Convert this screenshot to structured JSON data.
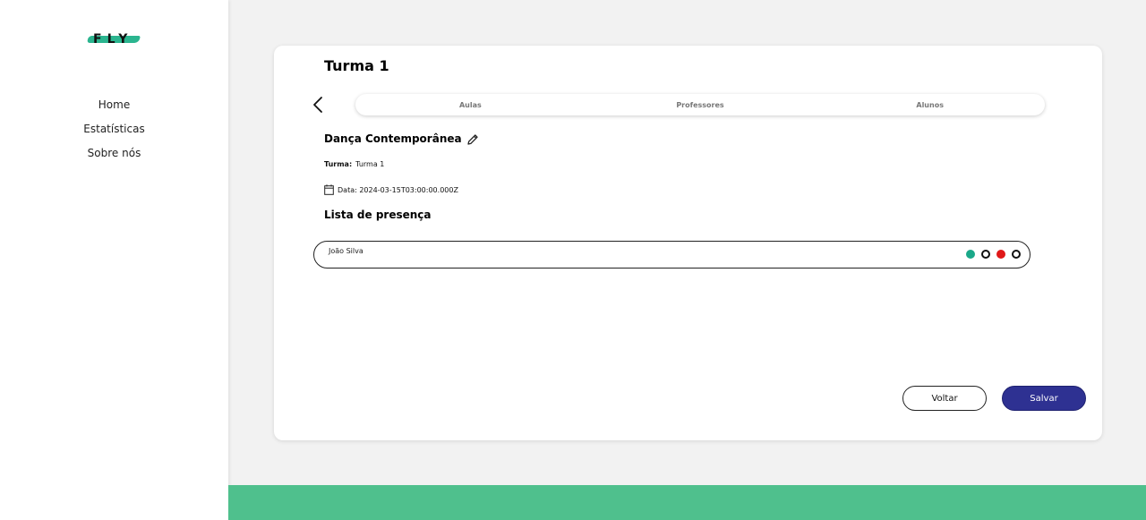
{
  "brand": {
    "logo_text": "FLY",
    "accent": "#2bb58f"
  },
  "sidebar": {
    "items": [
      {
        "label": "Home"
      },
      {
        "label": "Estatísticas"
      },
      {
        "label": "Sobre nós"
      }
    ]
  },
  "card": {
    "title": "Turma 1",
    "tabs": [
      {
        "label": "Aulas"
      },
      {
        "label": "Professores"
      },
      {
        "label": "Alunos"
      }
    ],
    "subject": "Dança Contemporânea",
    "turma_label": "Turma:",
    "turma_value": "Turma 1",
    "date_text": "Data: 2024-03-15T03:00:00.000Z",
    "attendance_title": "Lista de presença",
    "students": [
      {
        "name": "João Silva",
        "status_colors": [
          "#1aa889",
          "outline",
          "#e01818",
          "outline"
        ]
      }
    ],
    "buttons": {
      "back_label": "Voltar",
      "save_label": "Salvar"
    }
  },
  "colors": {
    "footer": "#4fc08d",
    "save_button": "#2e3192"
  }
}
